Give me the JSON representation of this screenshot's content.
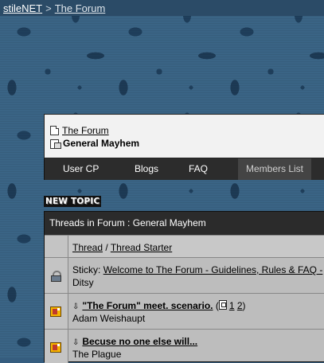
{
  "site": {
    "name": "stileNET",
    "separator": ">",
    "current": "The Forum"
  },
  "breadcrumb": {
    "parent": "The Forum",
    "current": "General Mayhem"
  },
  "nav": {
    "items": [
      {
        "label": "User CP"
      },
      {
        "label": "Blogs"
      },
      {
        "label": "FAQ"
      },
      {
        "label": "Members List"
      }
    ]
  },
  "new_topic_label": "NEW TOPIC",
  "threads": {
    "header": "Threads in Forum : General Mayhem",
    "col_thread": "Thread",
    "col_sep": "/",
    "col_starter": "Thread Starter",
    "rows": [
      {
        "prefix": "Sticky:",
        "title": "Welcome to The Forum - Guidelines, Rules & FAQ -",
        "starter": "Ditsy",
        "icon": "lock-icon"
      },
      {
        "title": "\"The Forum\" meet. scenario.",
        "pages_open": "(",
        "page1": "1",
        "page2": "2",
        "pages_close": ")",
        "starter": "Adam Weishaupt",
        "icon": "hot-folder-icon"
      },
      {
        "title": "Becuse no one else will...",
        "starter": "The Plague",
        "icon": "hot-folder-icon"
      }
    ]
  },
  "colors": {
    "background": "#355d7f",
    "topbar": "#2b4b67",
    "navbar": "#2c2c2c",
    "panel": "#bdbdbd"
  }
}
